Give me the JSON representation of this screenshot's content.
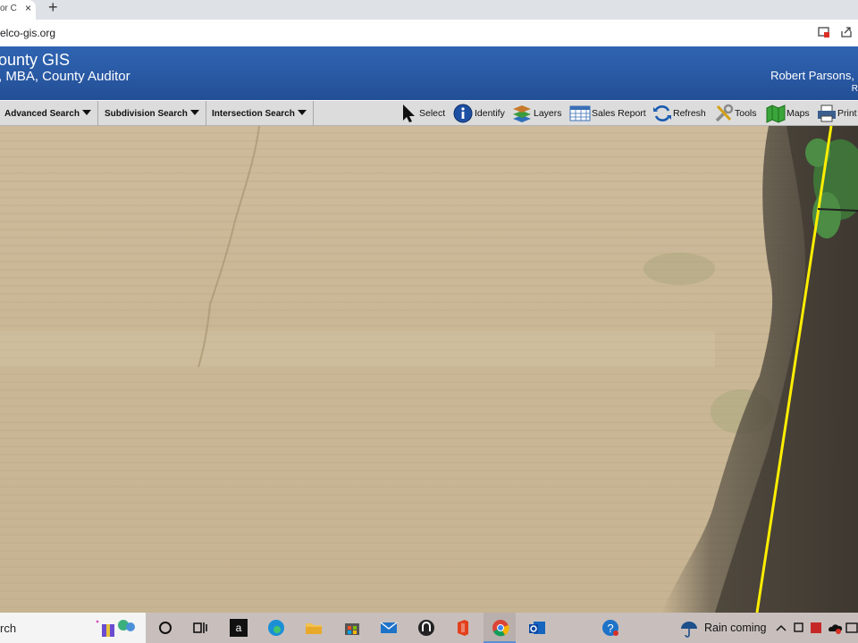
{
  "browser": {
    "tab_title": "or C",
    "tab_close": "×",
    "new_tab": "+",
    "url": "elco-gis.org"
  },
  "header": {
    "title": "ounty GIS",
    "subtitle": ", MBA, County Auditor",
    "user": "Robert Parsons,",
    "user_sub": "R"
  },
  "toolbar": {
    "menus": [
      "Advanced Search",
      "Subdivision Search",
      "Intersection Search"
    ],
    "tools": [
      "Select",
      "Identify",
      "Layers",
      "Sales Report",
      "Refresh",
      "Tools",
      "Maps",
      "Print"
    ]
  },
  "map": {
    "parcel_line_color": "#ffee00"
  },
  "taskbar": {
    "search_text": "rch",
    "weather_text": "Rain coming"
  }
}
